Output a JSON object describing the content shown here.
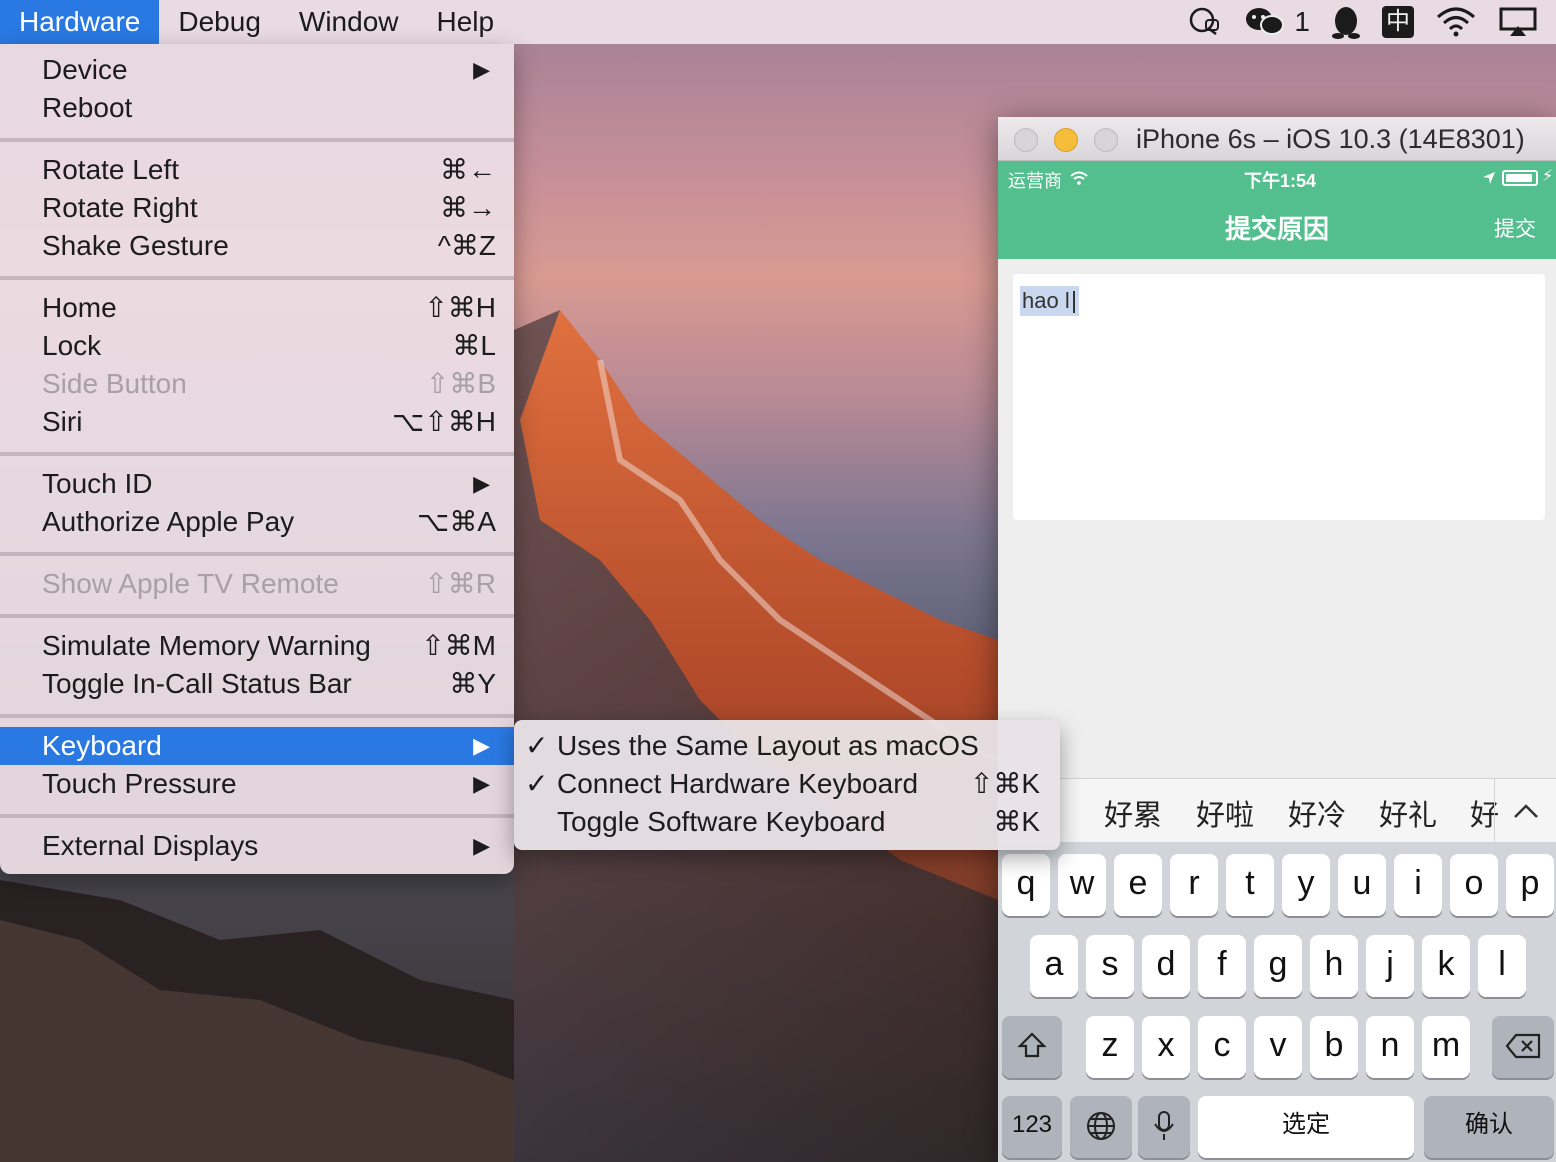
{
  "menubar": {
    "items": [
      "Hardware",
      "Debug",
      "Window",
      "Help"
    ],
    "active_index": 0,
    "tray": {
      "wechat_count": "1",
      "input_method": "中"
    }
  },
  "hardware_menu": {
    "rows": [
      {
        "label": "Device",
        "shortcut": "",
        "submenu": true,
        "disabled": false
      },
      {
        "label": "Reboot",
        "shortcut": "",
        "submenu": false,
        "disabled": false
      },
      {
        "label": "Rotate Left",
        "shortcut": "⌘←",
        "submenu": false,
        "disabled": false
      },
      {
        "label": "Rotate Right",
        "shortcut": "⌘→",
        "submenu": false,
        "disabled": false
      },
      {
        "label": "Shake Gesture",
        "shortcut": "^⌘Z",
        "submenu": false,
        "disabled": false
      },
      {
        "label": "Home",
        "shortcut": "⇧⌘H",
        "submenu": false,
        "disabled": false
      },
      {
        "label": "Lock",
        "shortcut": "⌘L",
        "submenu": false,
        "disabled": false
      },
      {
        "label": "Side Button",
        "shortcut": "⇧⌘B",
        "submenu": false,
        "disabled": true
      },
      {
        "label": "Siri",
        "shortcut": "⌥⇧⌘H",
        "submenu": false,
        "disabled": false
      },
      {
        "label": "Touch ID",
        "shortcut": "",
        "submenu": true,
        "disabled": false
      },
      {
        "label": "Authorize Apple Pay",
        "shortcut": "⌥⌘A",
        "submenu": false,
        "disabled": false
      },
      {
        "label": "Show Apple TV Remote",
        "shortcut": "⇧⌘R",
        "submenu": false,
        "disabled": true
      },
      {
        "label": "Simulate Memory Warning",
        "shortcut": "⇧⌘M",
        "submenu": false,
        "disabled": false
      },
      {
        "label": "Toggle In-Call Status Bar",
        "shortcut": "⌘Y",
        "submenu": false,
        "disabled": false
      },
      {
        "label": "Keyboard",
        "shortcut": "",
        "submenu": true,
        "disabled": false,
        "highlighted": true
      },
      {
        "label": "Touch Pressure",
        "shortcut": "",
        "submenu": true,
        "disabled": false
      },
      {
        "label": "External Displays",
        "shortcut": "",
        "submenu": true,
        "disabled": false
      }
    ]
  },
  "keyboard_submenu": {
    "rows": [
      {
        "label": "Uses the Same Layout as macOS",
        "checked": true,
        "shortcut": ""
      },
      {
        "label": "Connect Hardware Keyboard",
        "checked": true,
        "shortcut": "⇧⌘K"
      },
      {
        "label": "Toggle Software Keyboard",
        "checked": false,
        "shortcut": "⌘K"
      }
    ]
  },
  "simulator": {
    "title": "iPhone 6s – iOS 10.3 (14E8301)",
    "status": {
      "carrier": "运营商",
      "time": "下午1:54"
    },
    "nav": {
      "title": "提交原因",
      "action": "提交"
    },
    "text_input_value": "hao l",
    "candidates": [
      "好累",
      "好啦",
      "好冷",
      "好礼",
      "好"
    ],
    "keyboard": {
      "row1": [
        "q",
        "w",
        "e",
        "r",
        "t",
        "y",
        "u",
        "i",
        "o",
        "p"
      ],
      "row2": [
        "a",
        "s",
        "d",
        "f",
        "g",
        "h",
        "j",
        "k",
        "l"
      ],
      "row3": [
        "z",
        "x",
        "c",
        "v",
        "b",
        "n",
        "m"
      ],
      "numbers_key": "123",
      "space_key": "选定",
      "return_key": "确认"
    }
  },
  "colors": {
    "accent": "#2a79e3",
    "ios_nav_green": "#54bf8e"
  }
}
